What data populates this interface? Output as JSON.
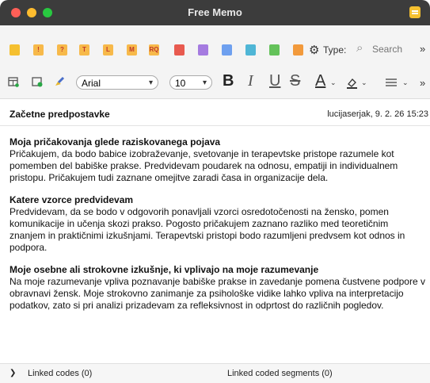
{
  "window": {
    "title": "Free Memo"
  },
  "toolbar1": {
    "memo_icons": [
      {
        "name": "memo-yellow-icon",
        "color": "#f5c030",
        "glyph": ""
      },
      {
        "name": "memo-important-icon",
        "color": "#f7b94a",
        "glyph": "!"
      },
      {
        "name": "memo-question-icon",
        "color": "#f7b94a",
        "glyph": "?"
      },
      {
        "name": "memo-theory-icon",
        "color": "#f7b94a",
        "glyph": "T"
      },
      {
        "name": "memo-literature-icon",
        "color": "#f7b94a",
        "glyph": "L"
      },
      {
        "name": "memo-method-icon",
        "color": "#f7b94a",
        "glyph": "M"
      },
      {
        "name": "memo-rq-icon",
        "color": "#f7b94a",
        "glyph": "RQ"
      },
      {
        "name": "memo-red-icon",
        "color": "#e85a4f",
        "glyph": ""
      },
      {
        "name": "memo-violet-icon",
        "color": "#a57be0",
        "glyph": ""
      },
      {
        "name": "memo-blue-icon",
        "color": "#6ea0ef",
        "glyph": ""
      },
      {
        "name": "memo-cyan-icon",
        "color": "#4fb6d6",
        "glyph": ""
      },
      {
        "name": "memo-green-icon",
        "color": "#64c25a",
        "glyph": ""
      },
      {
        "name": "memo-orange-icon",
        "color": "#f29a3c",
        "glyph": ""
      }
    ],
    "type_label": "Type:",
    "search_placeholder": "Search",
    "more": "»"
  },
  "toolbar2": {
    "font_name": "Arial",
    "font_size": "10",
    "bold": "B",
    "italic": "I",
    "underline": "U",
    "strike": "S",
    "text_color": "A",
    "more": "»"
  },
  "memo": {
    "title": "Začetne predpostavke",
    "meta": "lucijaserjak, 9. 2. 26 15:23",
    "sections": [
      {
        "heading": "Moja pričakovanja glede raziskovanega pojava",
        "body": "Pričakujem, da bodo babice izobraževanje, svetovanje in terapevtske pristope razumele kot pomemben del babiške prakse. Predvidevam poudarek na odnosu, empatiji in individualnem pristopu. Pričakujem tudi zaznane omejitve zaradi časa in organizacije dela."
      },
      {
        "heading": "Katere vzorce predvidevam",
        "body": "Predvidevam, da se bodo v odgovorih ponavljali vzorci osredotočenosti na žensko, pomen komunikacije in učenja skozi prakso. Pogosto pričakujem zaznano razliko med teoretičnim znanjem in praktičnimi izkušnjami. Terapevtski pristopi bodo razumljeni predvsem kot odnos in podpora."
      },
      {
        "heading": "Moje osebne ali strokovne izkušnje, ki vplivajo na moje razumevanje",
        "body": "Na moje razumevanje vpliva poznavanje babiške prakse in zavedanje pomena čustvene podpore v obravnavi žensk. Moje strokovno zanimanje za psihološke vidike lahko vpliva na interpretacijo podatkov, zato si pri analizi prizadevam za refleksivnost in odprtost do različnih pogledov."
      }
    ]
  },
  "footer": {
    "linked_codes": "Linked codes (0)",
    "linked_segments": "Linked coded segments (0)"
  }
}
